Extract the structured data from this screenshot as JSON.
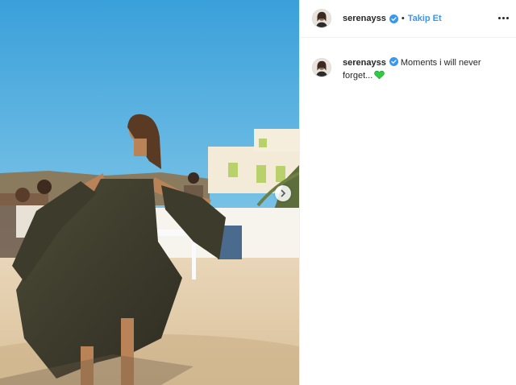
{
  "post": {
    "username": "serenayss",
    "dot": "•",
    "follow_label": "Takip Et",
    "caption_text": "Moments i will never forget...",
    "caption_emoji": "green-heart-icon"
  },
  "colors": {
    "link_blue": "#3897f0",
    "verified_blue": "#3897f0",
    "heart_green": "#2ecc40",
    "sky": "#6fb9e3"
  },
  "icons": {
    "verified": "verified-badge-icon",
    "more": "more-options-icon",
    "carousel": "chevron-right-icon"
  }
}
